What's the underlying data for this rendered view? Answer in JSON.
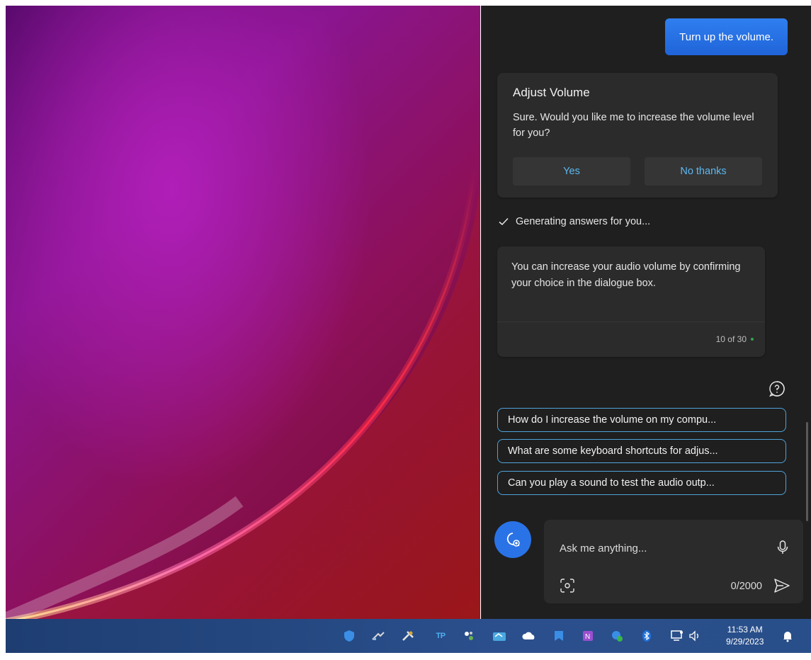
{
  "chat": {
    "user_message": "Turn up the volume.",
    "confirm_card": {
      "title": "Adjust Volume",
      "message": "Sure. Would you like me to increase the volume level for you?",
      "yes_label": "Yes",
      "no_label": "No thanks"
    },
    "status": "Generating answers for you...",
    "answer": {
      "text": "You can increase your audio volume by confirming your choice in the dialogue box.",
      "counter": "10 of 30"
    },
    "suggestions": [
      "How do I increase the volume on my compu...",
      "What are some keyboard shortcuts for adjus...",
      "Can you play a sound to test the audio outp..."
    ],
    "input": {
      "placeholder": "Ask me anything...",
      "char_count": "0/2000"
    }
  },
  "taskbar": {
    "time": "11:53 AM",
    "date": "9/29/2023",
    "tray_icons": [
      "defender-icon",
      "network-tool-icon",
      "tool-icon",
      "tp-icon",
      "app-icon",
      "sync-icon",
      "onedrive-icon",
      "bookmark-icon",
      "onenote-icon",
      "security-icon",
      "bluetooth-icon",
      "network-icon",
      "volume-icon",
      "notification-icon"
    ]
  },
  "colors": {
    "panel_bg": "#1f1f1f",
    "card_bg": "#2b2b2b",
    "accent_blue": "#2a73e6",
    "link_blue": "#5cb8f0",
    "chip_border": "#4fa3d9",
    "taskbar": "#2a4f8c"
  }
}
